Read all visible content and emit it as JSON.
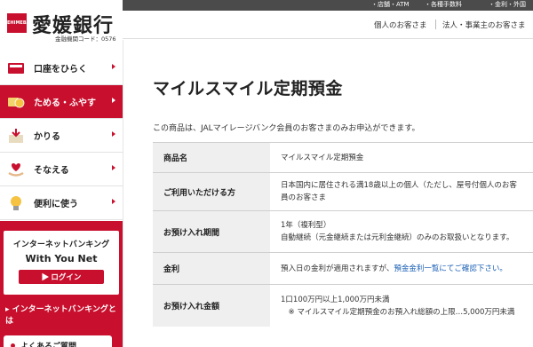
{
  "logo": {
    "mark": "EHIMEBANK",
    "name": "愛媛銀行",
    "code": "金融機関コード：0576"
  },
  "topbar": {
    "item1": "・店舗・ATM",
    "item2": "・各種手数料",
    "item3": "・金利・外国"
  },
  "subbar": {
    "personal": "個人のお客さま",
    "business": "法人・事業主のお客さま"
  },
  "sidebar": {
    "items": [
      {
        "label": "口座をひらく",
        "icon": "passbook-icon"
      },
      {
        "label": "ためる・ふやす",
        "icon": "coins-icon"
      },
      {
        "label": "かりる",
        "icon": "cash-box-icon"
      },
      {
        "label": "そなえる",
        "icon": "heart-hand-icon"
      },
      {
        "label": "便利に使う",
        "icon": "lightbulb-icon"
      }
    ]
  },
  "netbank": {
    "title": "インターネットバンキング",
    "subtitle": "With You Net",
    "login": "▶ ログイン",
    "link": "▸ インターネットバンキングとは",
    "faq": "よくあるご質問"
  },
  "main": {
    "title": "マイルスマイル定期預金",
    "intro": "この商品は、JALマイレージバンク会員のお客さまのみお申込ができます。",
    "table": [
      {
        "label": "商品名",
        "lines": [
          "マイルスマイル定期預金"
        ]
      },
      {
        "label": "ご利用いただける方",
        "lines": [
          "日本国内に居住される満18歳以上の個人（ただし、屋号付個人のお客",
          "員のお客さま"
        ]
      },
      {
        "label": "お預け入れ期間",
        "lines": [
          "1年（複利型）",
          "自動継続（元金継続または元利金継続）のみのお取扱いとなります。"
        ]
      },
      {
        "label": "金利",
        "pre": "預入日の金利が適用されますが、",
        "link": "預金金利一覧にてご確認下さい。"
      },
      {
        "label": "お預け入れ金額",
        "lines": [
          "1口100万円以上1,000万円未満",
          "　※ マイルスマイル定期預金のお預入れ総額の上限…5,000万円未満"
        ]
      }
    ]
  },
  "colors": {
    "brand": "#c8102e",
    "topbar": "#4b4b4b",
    "link": "#1a5fb4"
  }
}
